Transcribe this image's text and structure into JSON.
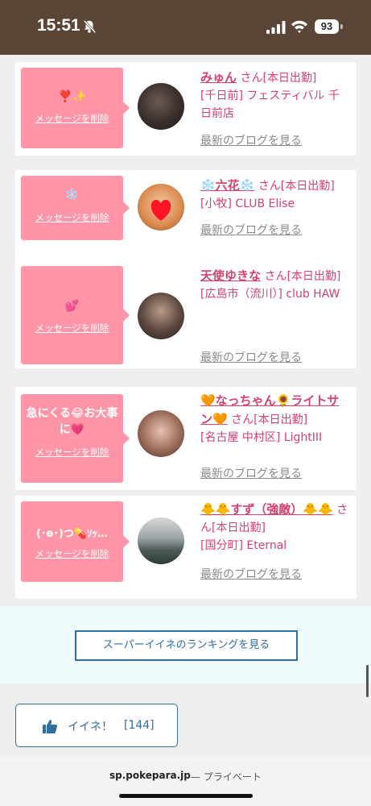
{
  "status_bar": {
    "time": "15:51",
    "battery": "93",
    "icons": [
      "bell-slash-icon",
      "signal-icon",
      "wifi-icon",
      "battery-icon"
    ]
  },
  "cards": [
    {
      "message": "❣️✨",
      "delete_label": "メッセージを削除",
      "name": "みゅん",
      "suffix": "さん[本日出勤]",
      "shop": "[千日前] フェスティバル 千日前店",
      "blog_label": "最新のブログを見る"
    },
    {
      "message": "❄️",
      "delete_label": "メッセージを削除",
      "name": "❄️六花❄️",
      "suffix": "さん[本日出勤]",
      "shop": "[小牧] CLUB Elise",
      "blog_label": "最新のブログを見る"
    },
    {
      "message": "💕",
      "delete_label": "メッセージを削除",
      "name": "天使ゆきな",
      "suffix": "さん[本日出勤]",
      "shop": "[広島市（流川）] club HAW",
      "blog_label": "最新のブログを見る"
    },
    {
      "message": "急にくる😂お大事に💗",
      "delete_label": "メッセージを削除",
      "name": "🧡なっちゃん🌻ライトサン🧡",
      "suffix": "さん[本日出勤]",
      "shop": "[名古屋 中村区] LightIII",
      "blog_label": "最新のブログを見る"
    },
    {
      "message": "(･ө･)つ💊ｿｯ…",
      "delete_label": "メッセージを削除",
      "name": "🐥🐥すず（強敵）🐥🐥",
      "suffix": "さん[本日出勤]",
      "shop": "[国分町] Eternal",
      "blog_label": "最新のブログを見る"
    }
  ],
  "ranking_button": "スーパーイイネのランキングを見る",
  "like_button": {
    "label": "イイネ！",
    "count": "[144]"
  },
  "browser": {
    "domain": "sp.pokepara.jp",
    "private": "— プライベート"
  }
}
